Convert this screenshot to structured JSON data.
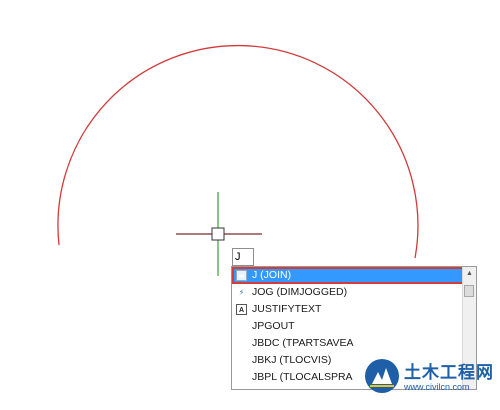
{
  "command_line": {
    "value": "J"
  },
  "autocomplete": {
    "items": [
      {
        "label": "J (JOIN)",
        "icon": "join-icon",
        "selected": true
      },
      {
        "label": "JOG (DIMJOGGED)",
        "icon": "dimjogged-icon",
        "selected": false
      },
      {
        "label": "JUSTIFYTEXT",
        "icon": "justifytext-icon",
        "selected": false
      },
      {
        "label": "JPGOUT",
        "icon": "",
        "selected": false
      },
      {
        "label": "JBDC (TPARTSAVEA",
        "icon": "",
        "selected": false
      },
      {
        "label": "JBKJ (TLOCVIS)",
        "icon": "",
        "selected": false
      },
      {
        "label": "JBPL (TLOCALSPRA",
        "icon": "",
        "selected": false
      }
    ]
  },
  "colors": {
    "arc": "#d23a3a",
    "crosshair_vertical": "#3aa13a",
    "crosshair_horizontal": "#7a2a2a",
    "selection": "#3399ff",
    "highlight_border": "#d43b3b"
  },
  "watermark": {
    "title": "土木工程网",
    "url": "www.civilcn.com"
  }
}
